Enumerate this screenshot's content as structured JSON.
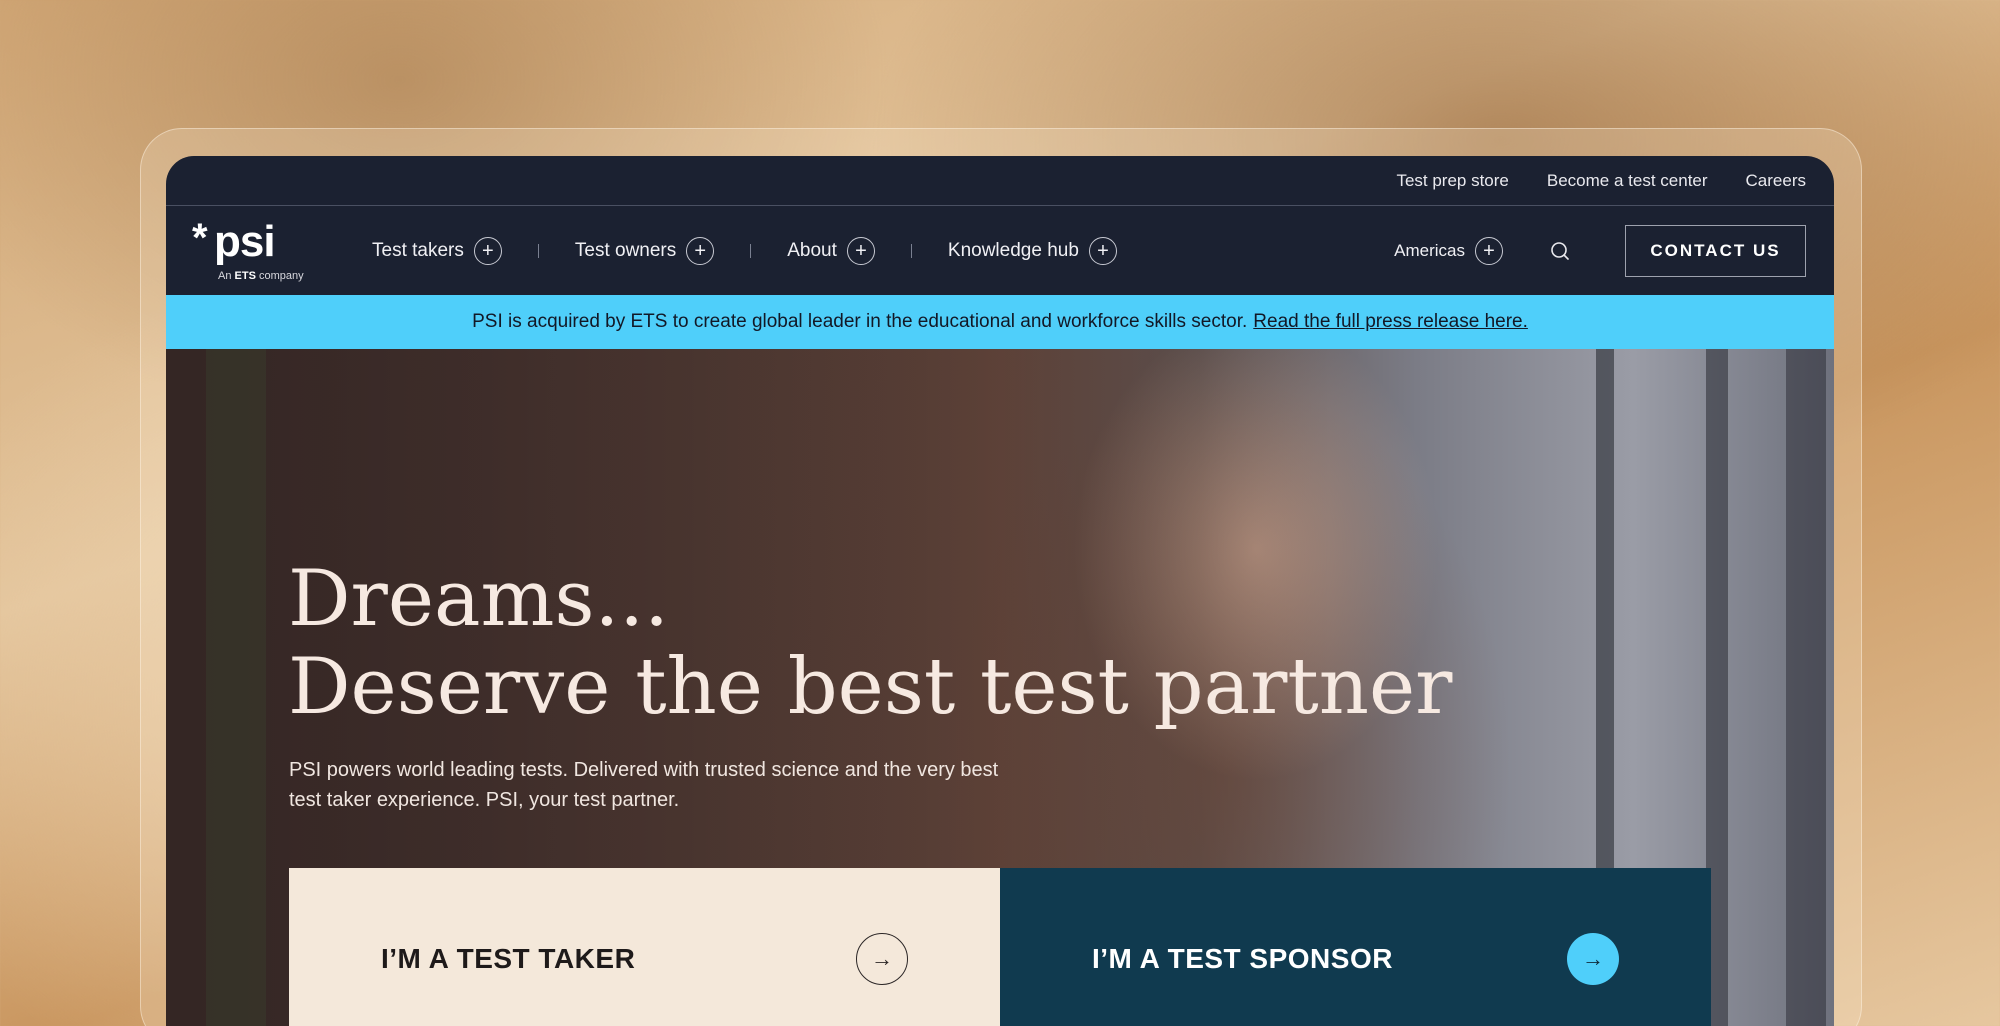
{
  "utility_nav": [
    "Test prep store",
    "Become a test center",
    "Careers"
  ],
  "logo": {
    "mark": "*",
    "word": "psi",
    "sub_prefix": "An",
    "sub_brand": "ETS",
    "sub_suffix": "company"
  },
  "main_nav": {
    "items": [
      {
        "label": "Test takers",
        "icon": "plus-icon"
      },
      {
        "label": "Test owners",
        "icon": "plus-icon"
      },
      {
        "label": "About",
        "icon": "plus-icon"
      },
      {
        "label": "Knowledge hub",
        "icon": "plus-icon"
      }
    ],
    "region": "Americas",
    "search_icon": "search-icon",
    "contact_label": "CONTACT US"
  },
  "announcement": {
    "text": "PSI is acquired by ETS to create global leader in the educational and workforce skills sector.",
    "link": "Read the full press release here."
  },
  "hero": {
    "title_line1": "Dreams...",
    "title_line2": "Deserve the best test partner",
    "subtitle": "PSI powers world leading tests. Delivered with trusted science and the very best test taker experience. PSI, your test partner.",
    "cta": [
      {
        "label": "I’M A TEST TAKER",
        "icon": "arrow-right-icon"
      },
      {
        "label": "I’M A TEST SPONSOR",
        "icon": "arrow-right-icon"
      }
    ]
  },
  "colors": {
    "nav_bg": "#1b2131",
    "announcement_bg": "#4fcffa",
    "cta_taker_bg": "#f4e8da",
    "cta_sponsor_bg": "#103a4f",
    "accent": "#4fcffa"
  }
}
